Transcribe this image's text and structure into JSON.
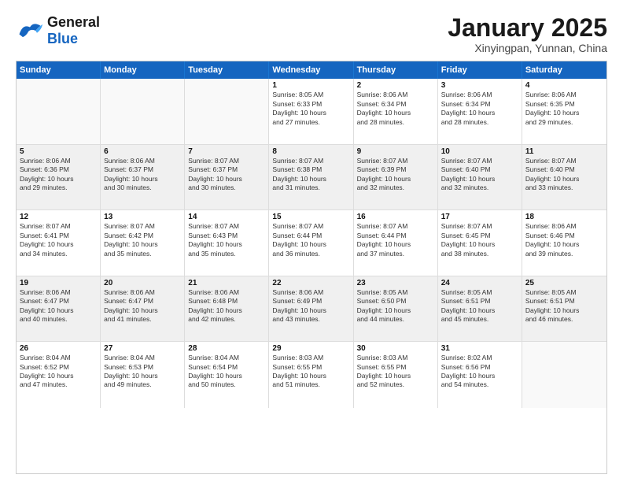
{
  "header": {
    "logo_general": "General",
    "logo_blue": "Blue",
    "month": "January 2025",
    "location": "Xinyingpan, Yunnan, China"
  },
  "days_of_week": [
    "Sunday",
    "Monday",
    "Tuesday",
    "Wednesday",
    "Thursday",
    "Friday",
    "Saturday"
  ],
  "weeks": [
    [
      {
        "day": "",
        "info": ""
      },
      {
        "day": "",
        "info": ""
      },
      {
        "day": "",
        "info": ""
      },
      {
        "day": "1",
        "info": "Sunrise: 8:05 AM\nSunset: 6:33 PM\nDaylight: 10 hours\nand 27 minutes."
      },
      {
        "day": "2",
        "info": "Sunrise: 8:06 AM\nSunset: 6:34 PM\nDaylight: 10 hours\nand 28 minutes."
      },
      {
        "day": "3",
        "info": "Sunrise: 8:06 AM\nSunset: 6:34 PM\nDaylight: 10 hours\nand 28 minutes."
      },
      {
        "day": "4",
        "info": "Sunrise: 8:06 AM\nSunset: 6:35 PM\nDaylight: 10 hours\nand 29 minutes."
      }
    ],
    [
      {
        "day": "5",
        "info": "Sunrise: 8:06 AM\nSunset: 6:36 PM\nDaylight: 10 hours\nand 29 minutes."
      },
      {
        "day": "6",
        "info": "Sunrise: 8:06 AM\nSunset: 6:37 PM\nDaylight: 10 hours\nand 30 minutes."
      },
      {
        "day": "7",
        "info": "Sunrise: 8:07 AM\nSunset: 6:37 PM\nDaylight: 10 hours\nand 30 minutes."
      },
      {
        "day": "8",
        "info": "Sunrise: 8:07 AM\nSunset: 6:38 PM\nDaylight: 10 hours\nand 31 minutes."
      },
      {
        "day": "9",
        "info": "Sunrise: 8:07 AM\nSunset: 6:39 PM\nDaylight: 10 hours\nand 32 minutes."
      },
      {
        "day": "10",
        "info": "Sunrise: 8:07 AM\nSunset: 6:40 PM\nDaylight: 10 hours\nand 32 minutes."
      },
      {
        "day": "11",
        "info": "Sunrise: 8:07 AM\nSunset: 6:40 PM\nDaylight: 10 hours\nand 33 minutes."
      }
    ],
    [
      {
        "day": "12",
        "info": "Sunrise: 8:07 AM\nSunset: 6:41 PM\nDaylight: 10 hours\nand 34 minutes."
      },
      {
        "day": "13",
        "info": "Sunrise: 8:07 AM\nSunset: 6:42 PM\nDaylight: 10 hours\nand 35 minutes."
      },
      {
        "day": "14",
        "info": "Sunrise: 8:07 AM\nSunset: 6:43 PM\nDaylight: 10 hours\nand 35 minutes."
      },
      {
        "day": "15",
        "info": "Sunrise: 8:07 AM\nSunset: 6:44 PM\nDaylight: 10 hours\nand 36 minutes."
      },
      {
        "day": "16",
        "info": "Sunrise: 8:07 AM\nSunset: 6:44 PM\nDaylight: 10 hours\nand 37 minutes."
      },
      {
        "day": "17",
        "info": "Sunrise: 8:07 AM\nSunset: 6:45 PM\nDaylight: 10 hours\nand 38 minutes."
      },
      {
        "day": "18",
        "info": "Sunrise: 8:06 AM\nSunset: 6:46 PM\nDaylight: 10 hours\nand 39 minutes."
      }
    ],
    [
      {
        "day": "19",
        "info": "Sunrise: 8:06 AM\nSunset: 6:47 PM\nDaylight: 10 hours\nand 40 minutes."
      },
      {
        "day": "20",
        "info": "Sunrise: 8:06 AM\nSunset: 6:47 PM\nDaylight: 10 hours\nand 41 minutes."
      },
      {
        "day": "21",
        "info": "Sunrise: 8:06 AM\nSunset: 6:48 PM\nDaylight: 10 hours\nand 42 minutes."
      },
      {
        "day": "22",
        "info": "Sunrise: 8:06 AM\nSunset: 6:49 PM\nDaylight: 10 hours\nand 43 minutes."
      },
      {
        "day": "23",
        "info": "Sunrise: 8:05 AM\nSunset: 6:50 PM\nDaylight: 10 hours\nand 44 minutes."
      },
      {
        "day": "24",
        "info": "Sunrise: 8:05 AM\nSunset: 6:51 PM\nDaylight: 10 hours\nand 45 minutes."
      },
      {
        "day": "25",
        "info": "Sunrise: 8:05 AM\nSunset: 6:51 PM\nDaylight: 10 hours\nand 46 minutes."
      }
    ],
    [
      {
        "day": "26",
        "info": "Sunrise: 8:04 AM\nSunset: 6:52 PM\nDaylight: 10 hours\nand 47 minutes."
      },
      {
        "day": "27",
        "info": "Sunrise: 8:04 AM\nSunset: 6:53 PM\nDaylight: 10 hours\nand 49 minutes."
      },
      {
        "day": "28",
        "info": "Sunrise: 8:04 AM\nSunset: 6:54 PM\nDaylight: 10 hours\nand 50 minutes."
      },
      {
        "day": "29",
        "info": "Sunrise: 8:03 AM\nSunset: 6:55 PM\nDaylight: 10 hours\nand 51 minutes."
      },
      {
        "day": "30",
        "info": "Sunrise: 8:03 AM\nSunset: 6:55 PM\nDaylight: 10 hours\nand 52 minutes."
      },
      {
        "day": "31",
        "info": "Sunrise: 8:02 AM\nSunset: 6:56 PM\nDaylight: 10 hours\nand 54 minutes."
      },
      {
        "day": "",
        "info": ""
      }
    ]
  ]
}
